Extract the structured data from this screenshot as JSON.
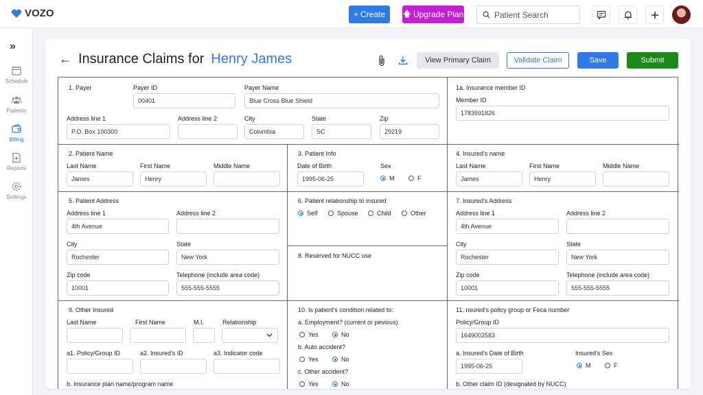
{
  "app": {
    "logo_text": "VOZO",
    "accent_color": "#2f7be6"
  },
  "topbar": {
    "create_label": "Create",
    "upgrade_label": "Upgrade Plan",
    "search_placeholder": "Patient Search",
    "icons": [
      "chat-icon",
      "bell-icon",
      "plus-icon"
    ]
  },
  "sidebar": {
    "items": [
      {
        "label": "Schedule",
        "icon": "calendar-icon"
      },
      {
        "label": "Patients",
        "icon": "users-icon"
      },
      {
        "label": "Billing",
        "icon": "wallet-icon",
        "active": true
      },
      {
        "label": "Reports",
        "icon": "report-icon"
      },
      {
        "label": "Settings",
        "icon": "gear-icon"
      }
    ]
  },
  "header": {
    "title_prefix": "Insurance Claims for",
    "patient_name": "Henry James",
    "view_primary_label": "View Primary Claim",
    "validate_label": "Validate Claim",
    "save_label": "Save",
    "submit_label": "Submit"
  },
  "payer": {
    "heading": "1. Payer",
    "payer_id_label": "Payer ID",
    "payer_id": "00401",
    "payer_name_label": "Payer Name",
    "payer_name": "Blue Cross Blue Shield",
    "addr1_label": "Address line 1",
    "addr1": "P.O. Box 100300",
    "addr2_label": "Address line 2",
    "addr2": "",
    "city_label": "City",
    "city": "Columbia",
    "state_label": "State",
    "state": "SC",
    "zip_label": "Zip",
    "zip": "29219"
  },
  "member": {
    "heading": "1a. Insurance member ID",
    "member_id_label": "Member ID",
    "member_id": "1783591826"
  },
  "patient_name": {
    "heading": "2. Patient Name",
    "last_label": "Last Name",
    "last": "James",
    "first_label": "First Name",
    "first": "Henry",
    "middle_label": "Middle Name",
    "middle": ""
  },
  "patient_info": {
    "heading": "3. Patient Info",
    "dob_label": "Date of Birth",
    "dob": "1995-06-25",
    "sex_label": "Sex",
    "sex_m": "M",
    "sex_f": "F",
    "sex_selected": "M"
  },
  "insured_name": {
    "heading": "4. Insured's name",
    "last_label": "Last Name",
    "last": "James",
    "first_label": "First Name",
    "first": "Henry",
    "middle_label": "Middle Name",
    "middle": ""
  },
  "patient_address": {
    "heading": "5. Patient Address",
    "addr1_label": "Address line 1",
    "addr1": "4th Avenue",
    "addr2_label": "Address line 2",
    "addr2": "",
    "city_label": "City",
    "city": "Rochester",
    "state_label": "State",
    "state": "New York",
    "zip_label": "Zip code",
    "zip": "10001",
    "phone_label": "Telephone (include area code)",
    "phone": "555-555-5555"
  },
  "relationship": {
    "heading": "6. Patient relationship to insured",
    "options": [
      "Self",
      "Spouse",
      "Child",
      "Other"
    ],
    "selected": "Self"
  },
  "nucc": {
    "heading": "8. Reserved for NUCC use"
  },
  "insured_address": {
    "heading": "7. Insured's Address",
    "addr1_label": "Address line 1",
    "addr1": "4th Avenue",
    "addr2_label": "Address line 2",
    "addr2": "",
    "city_label": "City",
    "city": "Rochester",
    "state_label": "State",
    "state": "New York",
    "zip_label": "Zip code",
    "zip": "10001",
    "phone_label": "Telephone (include area code)",
    "phone": "555-555-5555"
  },
  "other_insured": {
    "heading": "9. Other Insured",
    "last_label": "Last Name",
    "first_label": "First Name",
    "mi_label": "M.I.",
    "rel_label": "Relationship",
    "policy_label": "a1. Policy/Group ID",
    "insured_id_label": "a2. Insured's ID",
    "indicator_label": "a3. Indicator code",
    "plan_label": "b. Insurance plan name/program name"
  },
  "condition": {
    "heading": "10. Is patient's condition related to:",
    "employment_label": "a. Employment? (current or pevious)",
    "auto_label": "b. Auto accident?",
    "other_label": "c. Other accident?",
    "yes": "Yes",
    "no": "No",
    "employment": "No",
    "auto": "No",
    "other": "No"
  },
  "policy_group": {
    "heading": "11. nsured's policy group or Feca number",
    "policy_label": "Policy/Group ID",
    "policy": "1649002583",
    "dob_label": "a. Insured's Date of Birth",
    "dob": "1995-06-25",
    "sex_label": "Insured's Sex",
    "sex_m": "M",
    "sex_f": "F",
    "sex_selected": "M",
    "other_claim_label": "b. Other claim ID (designated by NUCC)"
  }
}
